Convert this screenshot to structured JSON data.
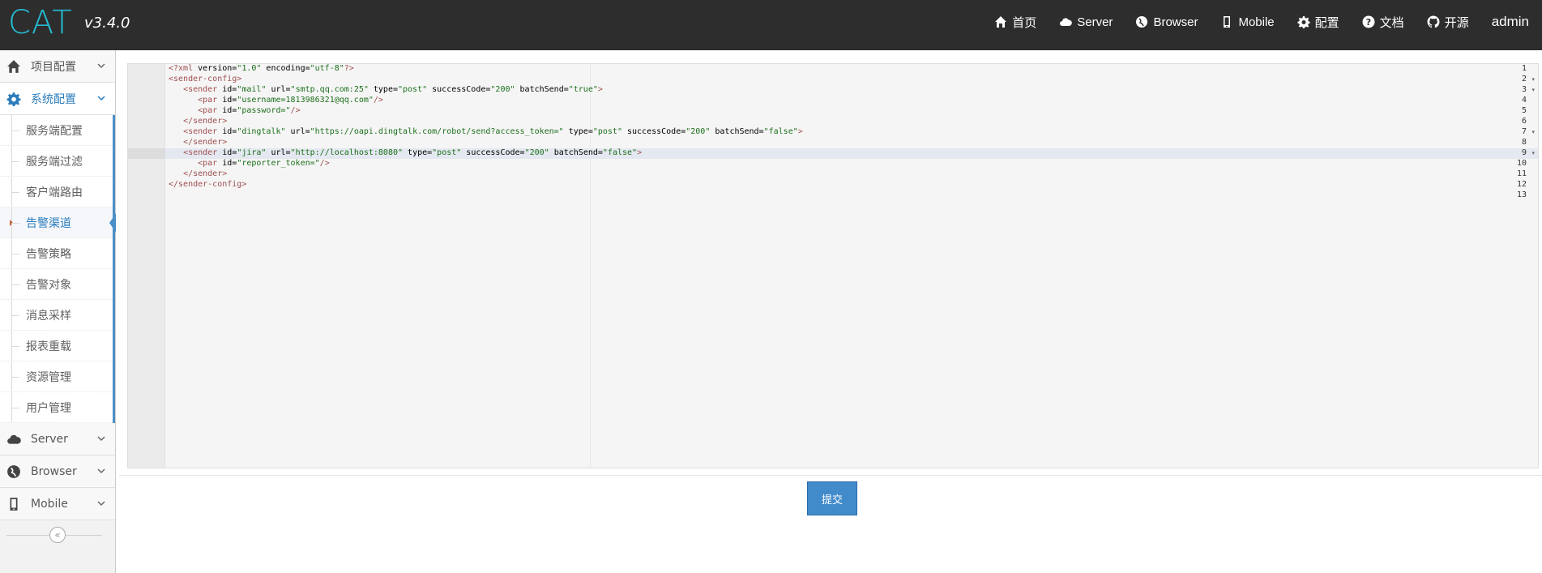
{
  "brand": {
    "logo": "CAT",
    "version": "v3.4.0",
    "accent": "#25bcd3"
  },
  "nav": {
    "items": [
      {
        "label": "首页",
        "icon": "home-icon"
      },
      {
        "label": "Server",
        "icon": "cloud-icon"
      },
      {
        "label": "Browser",
        "icon": "globe-icon"
      },
      {
        "label": "Mobile",
        "icon": "mobile-icon"
      },
      {
        "label": "配置",
        "icon": "gear-icon"
      },
      {
        "label": "文档",
        "icon": "question-icon"
      },
      {
        "label": "开源",
        "icon": "github-icon"
      }
    ],
    "user": "admin"
  },
  "sidebar": {
    "project_config": "项目配置",
    "system_config": "系统配置",
    "sub_items": [
      "服务端配置",
      "服务端过滤",
      "客户端路由",
      "告警渠道",
      "告警策略",
      "告警对象",
      "消息采样",
      "报表重载",
      "资源管理",
      "用户管理"
    ],
    "active_sub": "告警渠道",
    "server": "Server",
    "browser": "Browser",
    "mobile": "Mobile"
  },
  "editor": {
    "lines": [
      "<?xml version=\"1.0\" encoding=\"utf-8\"?>",
      "<sender-config>",
      "   <sender id=\"mail\" url=\"smtp.qq.com:25\" type=\"post\" successCode=\"200\" batchSend=\"true\">",
      "      <par id=\"username=1813986321@qq.com\"/>",
      "      <par id=\"password=\"/>",
      "   </sender>",
      "   <sender id=\"dingtalk\" url=\"https://oapi.dingtalk.com/robot/send?access_token=\" type=\"post\" successCode=\"200\" batchSend=\"false\">",
      "   </sender>",
      "   <sender id=\"jira\" url=\"http://localhost:8080\" type=\"post\" successCode=\"200\" batchSend=\"false\">",
      "      <par id=\"reporter_token=\"/>",
      "   </sender>",
      "</sender-config>",
      ""
    ],
    "line_numbers": [
      "1",
      "2",
      "3",
      "4",
      "5",
      "6",
      "7",
      "8",
      "9",
      "10",
      "11",
      "12",
      "13"
    ],
    "active_line": 9
  },
  "submit_label": "提交"
}
